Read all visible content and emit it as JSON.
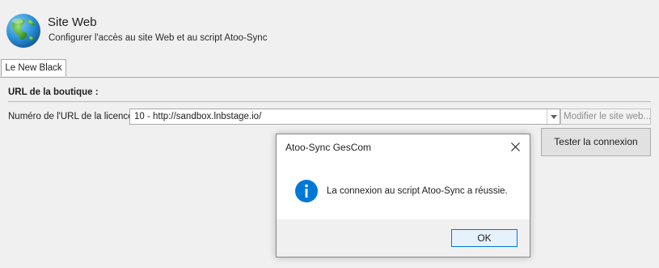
{
  "header": {
    "title": "Site Web",
    "subtitle": "Configurer l'accès au site Web et au script Atoo-Sync",
    "icon": "globe-icon"
  },
  "tabs": [
    {
      "label": "Le New Black",
      "active": true
    }
  ],
  "section": {
    "title": "URL de la boutique :"
  },
  "licence": {
    "label": "Numéro de l'URL de la licence :",
    "selected_value": "10 - http://sandbox.lnbstage.io/",
    "modify_button_label": "Modifier le site web...",
    "test_button_label": "Tester la connexion"
  },
  "dialog": {
    "title": "Atoo-Sync GesCom",
    "message": "La connexion au script Atoo-Sync a réussie.",
    "ok_label": "OK",
    "icon": "info-icon"
  },
  "colors": {
    "background": "#f0f0f0",
    "info_blue": "#0078d7",
    "ok_button_fill": "#e5f1fb"
  }
}
